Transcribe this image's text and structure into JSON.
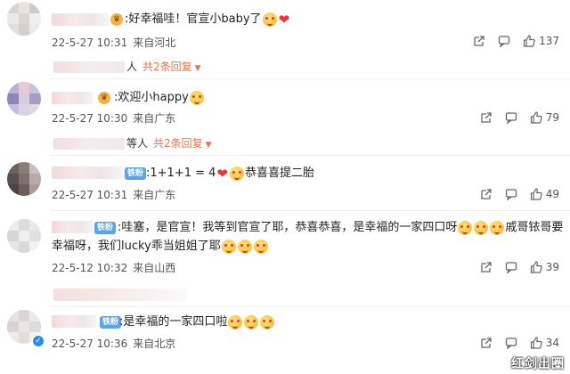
{
  "comments": [
    {
      "text_parts": [
        "好幸福哇！官宣小baby了"
      ],
      "date": "22-5-27 10:31",
      "location": "来自河北",
      "likes": "137",
      "reply_summary": "共2条回复",
      "reply_who": "人"
    },
    {
      "text_parts": [
        "欢迎小happy"
      ],
      "date": "22-5-27 10:30",
      "location": "来自广东",
      "likes": "79",
      "reply_summary": "共2条回复",
      "reply_who": "等人"
    },
    {
      "badge": "铁粉",
      "text_parts": [
        "1+1+1 = 4",
        "恭喜喜提二胎"
      ],
      "date": "22-5-27 10:31",
      "location": "来自广东",
      "likes": "49"
    },
    {
      "badge": "铁粉",
      "text_line1": "哇塞，是官宣！我等到官宣了耶，恭喜恭喜，是幸福的一家四口呀",
      "text_line1_tail": "戚哥铱哥要",
      "text_line2": "幸福呀，我们lucky乖当姐姐了耶",
      "date": "22-5-12 10:32",
      "location": "来自山西",
      "likes": "39"
    },
    {
      "badge": "铁粉",
      "text_parts": [
        ":是幸福的一家四口啦"
      ],
      "date": "22-5-27 10:36",
      "location": "来自北京",
      "likes": "34"
    }
  ],
  "watermark": "红剑出圈",
  "colors": {
    "accent": "#eb7350",
    "iron_badge": "#5ba4e8",
    "heart": "#e8363b"
  },
  "icons": [
    "share-icon",
    "comment-icon",
    "thumbs-up-icon",
    "heart-emoji",
    "smile-emoji",
    "verified-icon"
  ]
}
